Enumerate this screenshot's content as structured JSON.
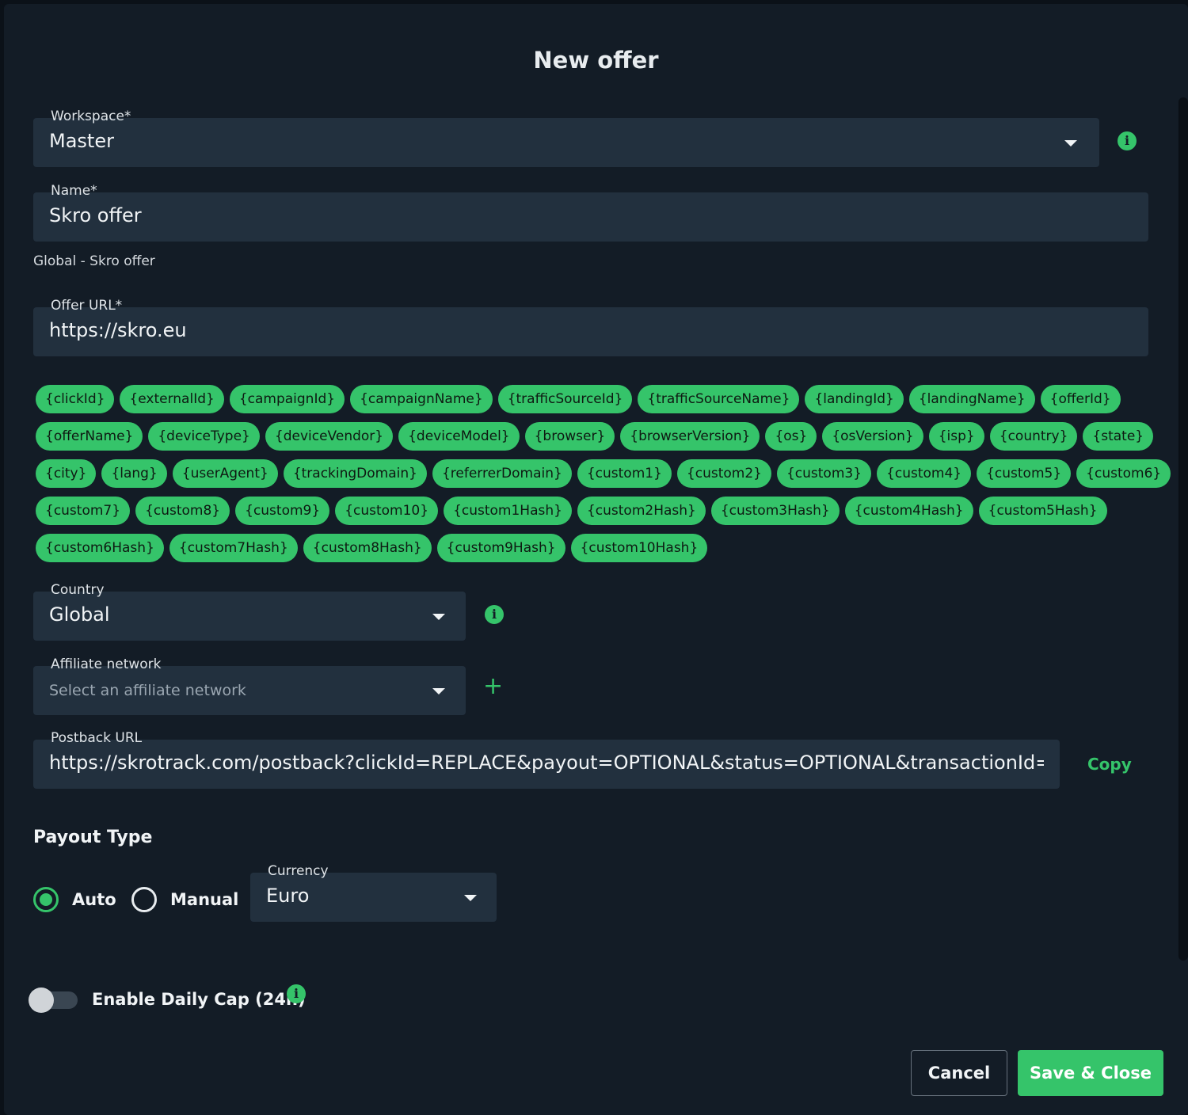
{
  "modal": {
    "title": "New offer"
  },
  "workspace": {
    "label": "Workspace*",
    "value": "Master"
  },
  "name": {
    "label": "Name*",
    "value": "Skro offer",
    "hint": "Global - Skro offer"
  },
  "offer_url": {
    "label": "Offer URL*",
    "value": "https://skro.eu"
  },
  "tokens": [
    [
      "{clickId}",
      "{externalId}",
      "{campaignId}",
      "{campaignName}",
      "{trafficSourceId}",
      "{trafficSourceName}",
      "{landingId}",
      "{landingName}",
      "{offerId}"
    ],
    [
      "{offerName}",
      "{deviceType}",
      "{deviceVendor}",
      "{deviceModel}",
      "{browser}",
      "{browserVersion}",
      "{os}",
      "{osVersion}",
      "{isp}",
      "{country}",
      "{state}"
    ],
    [
      "{city}",
      "{lang}",
      "{userAgent}",
      "{trackingDomain}",
      "{referrerDomain}",
      "{custom1}",
      "{custom2}",
      "{custom3}",
      "{custom4}",
      "{custom5}",
      "{custom6}"
    ],
    [
      "{custom7}",
      "{custom8}",
      "{custom9}",
      "{custom10}",
      "{custom1Hash}",
      "{custom2Hash}",
      "{custom3Hash}",
      "{custom4Hash}",
      "{custom5Hash}"
    ],
    [
      "{custom6Hash}",
      "{custom7Hash}",
      "{custom8Hash}",
      "{custom9Hash}",
      "{custom10Hash}"
    ]
  ],
  "country": {
    "label": "Country",
    "value": "Global"
  },
  "affiliate_network": {
    "label": "Affiliate network",
    "placeholder": "Select an affiliate network"
  },
  "postback": {
    "label": "Postback URL",
    "value": "https://skrotrack.com/postback?clickId=REPLACE&payout=OPTIONAL&status=OPTIONAL&transactionId=OPTIONAL",
    "copy_label": "Copy"
  },
  "payout": {
    "title": "Payout Type",
    "options": [
      {
        "label": "Auto",
        "checked": true
      },
      {
        "label": "Manual",
        "checked": false
      }
    ],
    "currency": {
      "label": "Currency",
      "value": "Euro"
    }
  },
  "daily_cap": {
    "label": "Enable Daily Cap (24h)",
    "enabled": false
  },
  "buttons": {
    "cancel": "Cancel",
    "save": "Save & Close"
  },
  "colors": {
    "accent": "#35c46a",
    "background": "#131c26",
    "field": "#22303e"
  },
  "icons": {
    "info": "info-icon",
    "dropdown": "chevron-down-icon",
    "add": "plus-icon"
  }
}
